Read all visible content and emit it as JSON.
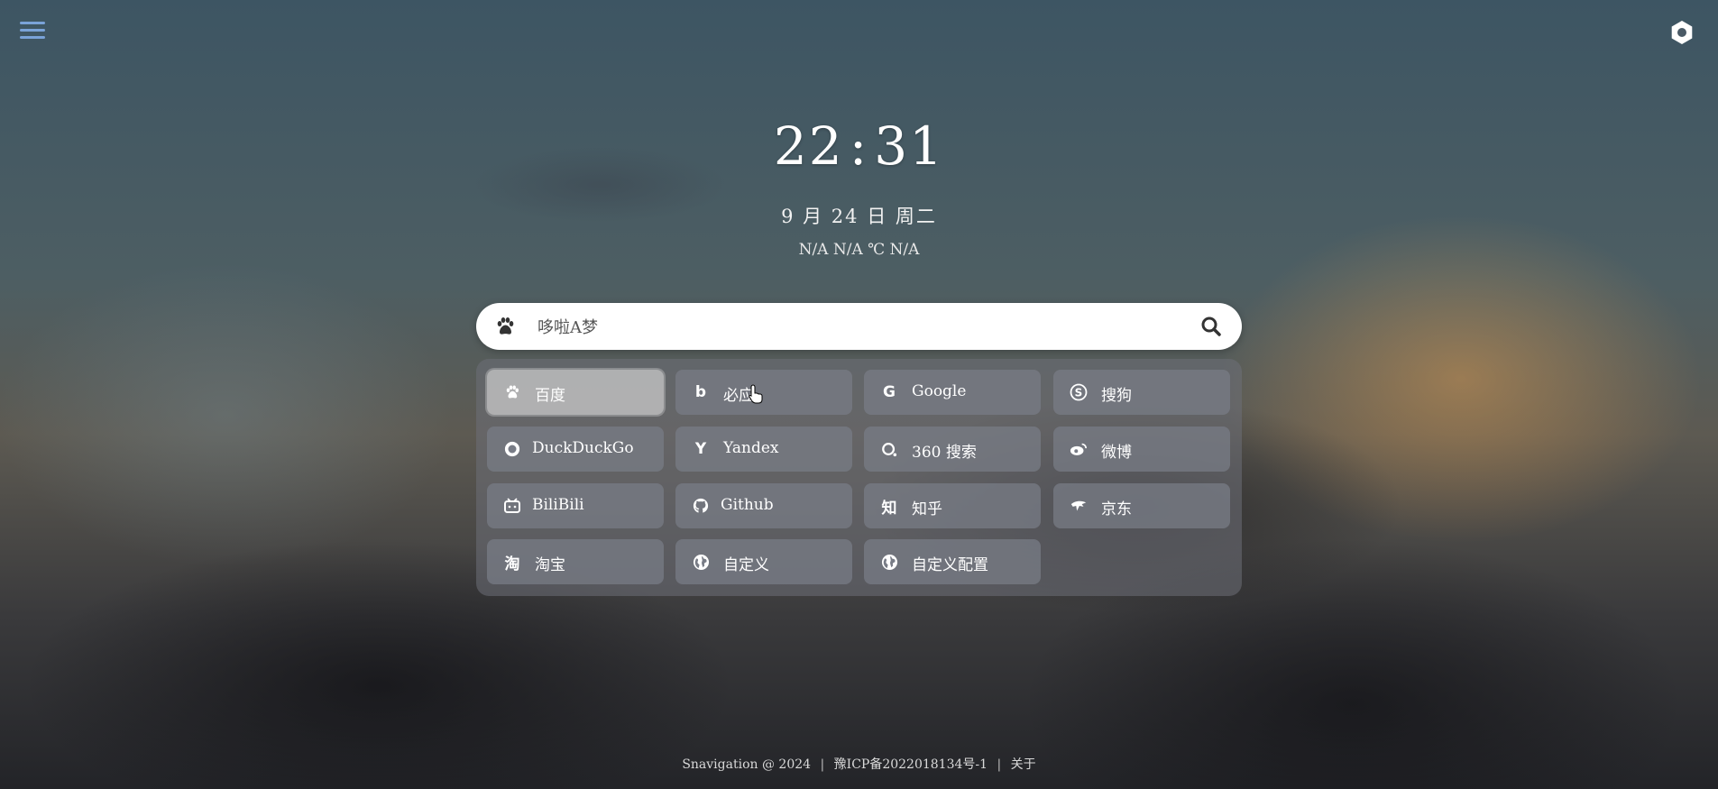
{
  "header": {
    "menu_icon": "hamburger-menu-icon",
    "settings_icon": "gear-icon"
  },
  "clock": {
    "hours": "22",
    "separator": ":",
    "minutes": "31"
  },
  "date": "9 月 24 日 周二",
  "weather": "N/A N/A ℃ N/A",
  "search": {
    "placeholder": "哆啦A梦",
    "engine_icon": "paw-icon",
    "submit_icon": "search-icon"
  },
  "engines": [
    {
      "label": "百度",
      "icon": "paw-icon"
    },
    {
      "label": "必应",
      "icon": "bing-icon"
    },
    {
      "label": "Google",
      "icon": "google-icon"
    },
    {
      "label": "搜狗",
      "icon": "sogou-icon"
    },
    {
      "label": "DuckDuckGo",
      "icon": "duckduckgo-icon"
    },
    {
      "label": "Yandex",
      "icon": "yandex-icon"
    },
    {
      "label": "360 搜索",
      "icon": "360-icon"
    },
    {
      "label": "微博",
      "icon": "weibo-icon"
    },
    {
      "label": "BiliBili",
      "icon": "bilibili-icon"
    },
    {
      "label": "Github",
      "icon": "github-icon"
    },
    {
      "label": "知乎",
      "icon": "zhihu-icon"
    },
    {
      "label": "京东",
      "icon": "jd-icon"
    },
    {
      "label": "淘宝",
      "icon": "taobao-icon"
    },
    {
      "label": "自定义",
      "icon": "globe-icon"
    },
    {
      "label": "自定义配置",
      "icon": "globe-icon"
    }
  ],
  "icon_glyphs": {
    "bing": "b",
    "google": "G",
    "sogou": "S",
    "yandex": "Y",
    "zhihu": "知",
    "taobao": "淘"
  },
  "footer": {
    "copyright": "Snavigation @ 2024",
    "icp": "豫ICP备2022018134号-1",
    "about": "关于"
  },
  "colors": {
    "menu_accent": "#7aa3d8",
    "text": "#ffffff"
  }
}
